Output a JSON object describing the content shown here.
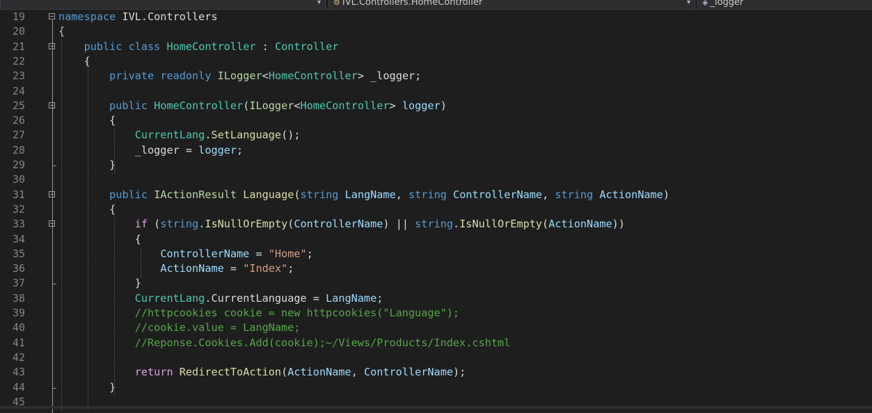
{
  "navbar": {
    "project_dropdown": "",
    "class_dropdown": "IVL.Controllers.HomeController",
    "class_icon": "class-icon",
    "member_dropdown": "_logger",
    "member_icon": "field-icon"
  },
  "editor": {
    "lines": [
      {
        "num": "19",
        "fold": true,
        "tokens": [
          [
            "kw",
            "namespace"
          ],
          [
            "pl",
            " IVL.Controllers"
          ]
        ]
      },
      {
        "num": "20",
        "fold": false,
        "tokens": [
          [
            "pl",
            "{"
          ]
        ]
      },
      {
        "num": "21",
        "fold": true,
        "tokens": [
          [
            "pl",
            "    "
          ],
          [
            "kw",
            "public"
          ],
          [
            "pl",
            " "
          ],
          [
            "kw",
            "class"
          ],
          [
            "pl",
            " "
          ],
          [
            "ty",
            "HomeController"
          ],
          [
            "pl",
            " : "
          ],
          [
            "ty",
            "Controller"
          ]
        ]
      },
      {
        "num": "22",
        "fold": false,
        "tokens": [
          [
            "pl",
            "    {"
          ]
        ]
      },
      {
        "num": "23",
        "fold": false,
        "tokens": [
          [
            "pl",
            "        "
          ],
          [
            "kw",
            "private"
          ],
          [
            "pl",
            " "
          ],
          [
            "kw",
            "readonly"
          ],
          [
            "pl",
            " "
          ],
          [
            "ity",
            "ILogger"
          ],
          [
            "pl",
            "<"
          ],
          [
            "ty",
            "HomeController"
          ],
          [
            "pl",
            "> _logger;"
          ]
        ]
      },
      {
        "num": "24",
        "fold": false,
        "tokens": []
      },
      {
        "num": "25",
        "fold": true,
        "tokens": [
          [
            "pl",
            "        "
          ],
          [
            "kw",
            "public"
          ],
          [
            "pl",
            " "
          ],
          [
            "ty",
            "HomeController"
          ],
          [
            "pl",
            "("
          ],
          [
            "ity",
            "ILogger"
          ],
          [
            "pl",
            "<"
          ],
          [
            "ty",
            "HomeController"
          ],
          [
            "pl",
            "> "
          ],
          [
            "pa",
            "logger"
          ],
          [
            "pl",
            ")"
          ]
        ]
      },
      {
        "num": "26",
        "fold": false,
        "tokens": [
          [
            "pl",
            "        {"
          ]
        ]
      },
      {
        "num": "27",
        "fold": false,
        "tokens": [
          [
            "pl",
            "            "
          ],
          [
            "ty",
            "CurrentLang"
          ],
          [
            "pl",
            "."
          ],
          [
            "mt",
            "SetLanguage"
          ],
          [
            "pl",
            "();"
          ]
        ]
      },
      {
        "num": "28",
        "fold": false,
        "tokens": [
          [
            "pl",
            "            _logger = "
          ],
          [
            "pa",
            "logger"
          ],
          [
            "pl",
            ";"
          ]
        ]
      },
      {
        "num": "29",
        "fold": false,
        "tokens": [
          [
            "pl",
            "        }"
          ]
        ]
      },
      {
        "num": "30",
        "fold": false,
        "tokens": []
      },
      {
        "num": "31",
        "fold": true,
        "tokens": [
          [
            "pl",
            "        "
          ],
          [
            "kw",
            "public"
          ],
          [
            "pl",
            " "
          ],
          [
            "ity",
            "IActionResult"
          ],
          [
            "pl",
            " "
          ],
          [
            "mt",
            "Language"
          ],
          [
            "pl",
            "("
          ],
          [
            "kw",
            "string"
          ],
          [
            "pl",
            " "
          ],
          [
            "pa",
            "LangName"
          ],
          [
            "pl",
            ", "
          ],
          [
            "kw",
            "string"
          ],
          [
            "pl",
            " "
          ],
          [
            "pa",
            "ControllerName"
          ],
          [
            "pl",
            ", "
          ],
          [
            "kw",
            "string"
          ],
          [
            "pl",
            " "
          ],
          [
            "pa",
            "ActionName"
          ],
          [
            "pl",
            ")"
          ]
        ]
      },
      {
        "num": "32",
        "fold": false,
        "tokens": [
          [
            "pl",
            "        {"
          ]
        ]
      },
      {
        "num": "33",
        "fold": true,
        "tokens": [
          [
            "pl",
            "            "
          ],
          [
            "ctl",
            "if"
          ],
          [
            "pl",
            " ("
          ],
          [
            "kw",
            "string"
          ],
          [
            "pl",
            "."
          ],
          [
            "mt",
            "IsNullOrEmpty"
          ],
          [
            "pl",
            "("
          ],
          [
            "pa",
            "ControllerName"
          ],
          [
            "pl",
            ") || "
          ],
          [
            "kw",
            "string"
          ],
          [
            "pl",
            "."
          ],
          [
            "mt",
            "IsNullOrEmpty"
          ],
          [
            "pl",
            "("
          ],
          [
            "pa",
            "ActionName"
          ],
          [
            "pl",
            "))"
          ]
        ]
      },
      {
        "num": "34",
        "fold": false,
        "tokens": [
          [
            "pl",
            "            {"
          ]
        ]
      },
      {
        "num": "35",
        "fold": false,
        "tokens": [
          [
            "pl",
            "                "
          ],
          [
            "pa",
            "ControllerName"
          ],
          [
            "pl",
            " = "
          ],
          [
            "st",
            "\"Home\""
          ],
          [
            "pl",
            ";"
          ]
        ]
      },
      {
        "num": "36",
        "fold": false,
        "tokens": [
          [
            "pl",
            "                "
          ],
          [
            "pa",
            "ActionName"
          ],
          [
            "pl",
            " = "
          ],
          [
            "st",
            "\"Index\""
          ],
          [
            "pl",
            ";"
          ]
        ]
      },
      {
        "num": "37",
        "fold": false,
        "tokens": [
          [
            "pl",
            "            }"
          ]
        ]
      },
      {
        "num": "38",
        "fold": false,
        "tokens": [
          [
            "pl",
            "            "
          ],
          [
            "ty",
            "CurrentLang"
          ],
          [
            "pl",
            ".CurrentLanguage = "
          ],
          [
            "pa",
            "LangName"
          ],
          [
            "pl",
            ";"
          ]
        ]
      },
      {
        "num": "39",
        "fold": false,
        "tokens": [
          [
            "pl",
            "            "
          ],
          [
            "cm",
            "//httpcookies cookie = new httpcookies(\"Language\");"
          ]
        ]
      },
      {
        "num": "40",
        "fold": false,
        "tokens": [
          [
            "pl",
            "            "
          ],
          [
            "cm",
            "//cookie.value = LangName;"
          ]
        ]
      },
      {
        "num": "41",
        "fold": false,
        "tokens": [
          [
            "pl",
            "            "
          ],
          [
            "cm",
            "//Reponse.Cookies.Add(cookie);~/Views/Products/Index.cshtml"
          ]
        ]
      },
      {
        "num": "42",
        "fold": false,
        "tokens": []
      },
      {
        "num": "43",
        "fold": false,
        "tokens": [
          [
            "pl",
            "            "
          ],
          [
            "ctl",
            "return"
          ],
          [
            "pl",
            " "
          ],
          [
            "mt",
            "RedirectToAction"
          ],
          [
            "pl",
            "("
          ],
          [
            "pa",
            "ActionName"
          ],
          [
            "pl",
            ", "
          ],
          [
            "pa",
            "ControllerName"
          ],
          [
            "pl",
            ");"
          ]
        ]
      },
      {
        "num": "44",
        "fold": false,
        "tokens": [
          [
            "pl",
            "        }"
          ]
        ]
      },
      {
        "num": "45",
        "fold": false,
        "tokens": []
      }
    ]
  },
  "theme": {
    "background": "#1e1e1e",
    "keyword": "#569cd6",
    "type": "#4ec9b0",
    "method": "#dcdcaa",
    "parameter": "#9cdcfe",
    "string": "#d69d85",
    "comment": "#57a64a"
  }
}
